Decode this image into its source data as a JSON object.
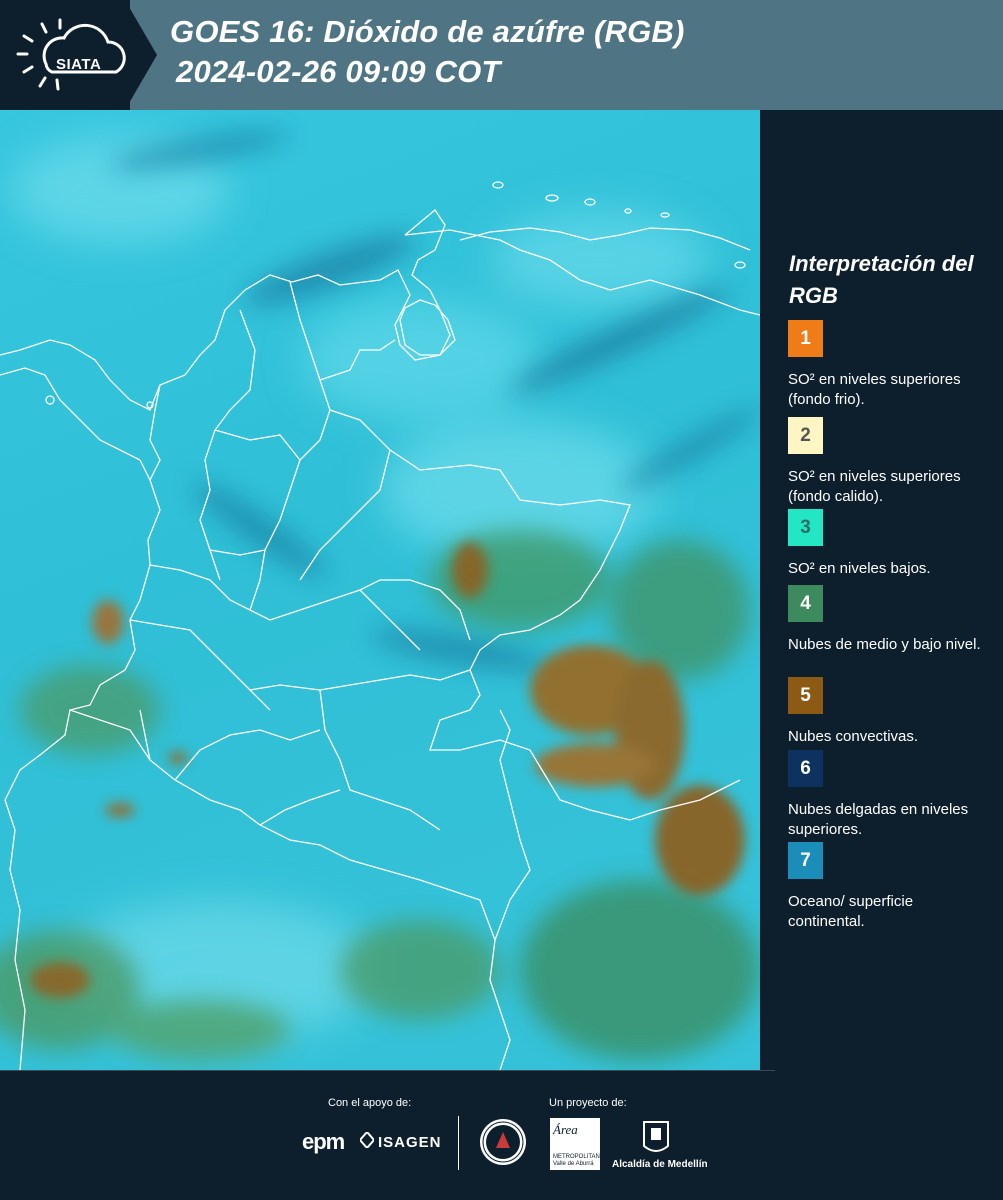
{
  "header": {
    "logo_text": "SIATA",
    "title_line1": "GOES 16: Dióxido de azúfre (RGB)",
    "title_line2": "2024-02-26 09:09 COT",
    "band_color": "#4f7585",
    "background_color": "#0d1f2d"
  },
  "map": {
    "base_color": "#2ec4dc",
    "convective_color": "#9a6a1e",
    "low_cloud_color": "#3f8a5e",
    "border_color": "#ffffff"
  },
  "legend": {
    "title": "Interpretación del RGB",
    "items": [
      {
        "number": "1",
        "color": "#f07c17",
        "num_color": "#ffffff",
        "label": "SO² en niveles superiores (fondo frio)."
      },
      {
        "number": "2",
        "color": "#fff6c4",
        "num_color": "#555555",
        "label": "SO² en niveles superiores (fondo calido)."
      },
      {
        "number": "3",
        "color": "#22e6c4",
        "num_color": "#2b6e62",
        "label": "SO² en niveles bajos."
      },
      {
        "number": "4",
        "color": "#3d8a5e",
        "num_color": "#ffffff",
        "label": "Nubes de medio y bajo nivel."
      },
      {
        "number": "5",
        "color": "#8c5a12",
        "num_color": "#ffffff",
        "label": "Nubes convectivas."
      },
      {
        "number": "6",
        "color": "#0d3260",
        "num_color": "#ffffff",
        "label": "Nubes delgadas en niveles superiores."
      },
      {
        "number": "7",
        "color": "#1a8db8",
        "num_color": "#ffffff",
        "label": "Oceano/ superficie continental."
      }
    ]
  },
  "footer": {
    "support_label": "Con el apoyo de:",
    "project_label": "Un proyecto de:",
    "sponsors": [
      "epm",
      "ISAGEN"
    ],
    "area_logo_text": "Área",
    "area_logo_sub": "METROPOLITANA Valle de Aburrá",
    "alcaldia_text": "Alcaldía de Medellín"
  }
}
